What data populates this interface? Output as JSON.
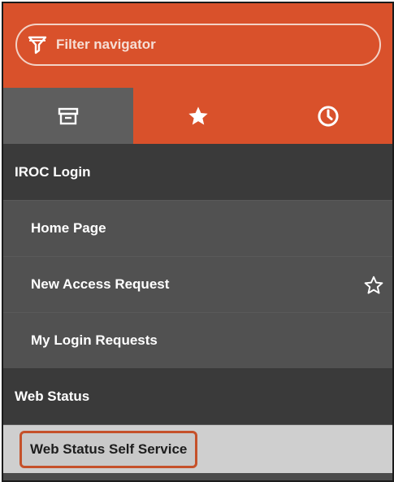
{
  "filter": {
    "placeholder": "Filter navigator",
    "icon": "filter-icon"
  },
  "tabs": [
    {
      "icon": "archive-icon",
      "active": true
    },
    {
      "icon": "star-icon",
      "active": false
    },
    {
      "icon": "clock-icon",
      "active": false
    }
  ],
  "nav": {
    "sections": [
      {
        "label": "IROC Login",
        "items": [
          {
            "label": "Home Page"
          },
          {
            "label": "New Access Request",
            "favorite_icon": "star-outline-icon"
          },
          {
            "label": "My Login Requests"
          }
        ]
      },
      {
        "label": "Web Status",
        "items": [
          {
            "label": "Web Status Self Service",
            "selected": true
          }
        ]
      }
    ]
  },
  "colors": {
    "accent": "#d9512b",
    "section_bg": "#3a3a3a",
    "item_bg": "#515151",
    "selected_bg": "#cfcfcf",
    "highlight_border": "#c5512a"
  }
}
